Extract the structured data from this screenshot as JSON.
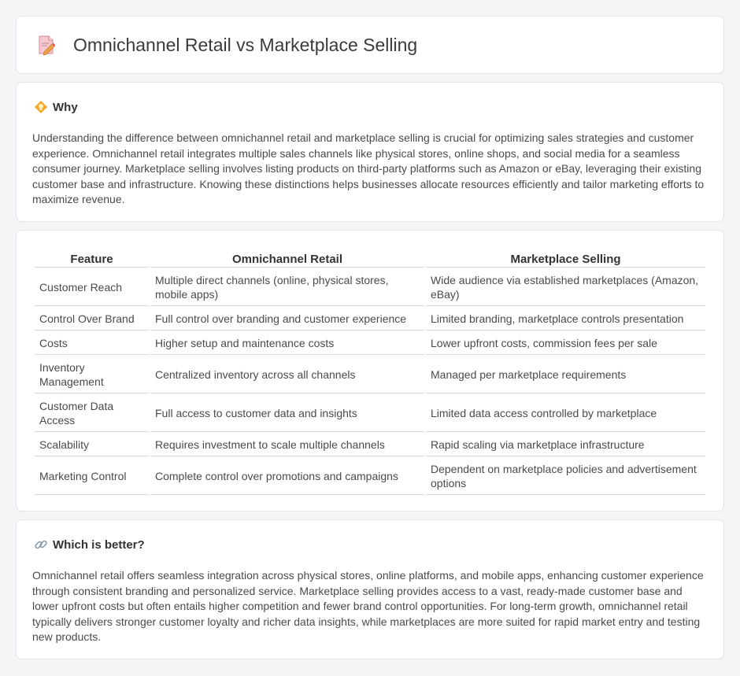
{
  "header": {
    "title": "Omnichannel Retail vs Marketplace Selling",
    "icon": "document-pencil-icon"
  },
  "why": {
    "title": "Why",
    "icon": "lightbulb-diamond-icon",
    "text": "Understanding the difference between omnichannel retail and marketplace selling is crucial for optimizing sales strategies and customer experience. Omnichannel retail integrates multiple sales channels like physical stores, online shops, and social media for a seamless consumer journey. Marketplace selling involves listing products on third-party platforms such as Amazon or eBay, leveraging their existing customer base and infrastructure. Knowing these distinctions helps businesses allocate resources efficiently and tailor marketing efforts to maximize revenue."
  },
  "table": {
    "headers": [
      "Feature",
      "Omnichannel Retail",
      "Marketplace Selling"
    ],
    "rows": [
      [
        "Customer Reach",
        "Multiple direct channels (online, physical stores, mobile apps)",
        "Wide audience via established marketplaces (Amazon, eBay)"
      ],
      [
        "Control Over Brand",
        "Full control over branding and customer experience",
        "Limited branding, marketplace controls presentation"
      ],
      [
        "Costs",
        "Higher setup and maintenance costs",
        "Lower upfront costs, commission fees per sale"
      ],
      [
        "Inventory Management",
        "Centralized inventory across all channels",
        "Managed per marketplace requirements"
      ],
      [
        "Customer Data Access",
        "Full access to customer data and insights",
        "Limited data access controlled by marketplace"
      ],
      [
        "Scalability",
        "Requires investment to scale multiple channels",
        "Rapid scaling via marketplace infrastructure"
      ],
      [
        "Marketing Control",
        "Complete control over promotions and campaigns",
        "Dependent on marketplace policies and advertisement options"
      ]
    ]
  },
  "better": {
    "title": "Which is better?",
    "icon": "link-icon",
    "text": "Omnichannel retail offers seamless integration across physical stores, online platforms, and mobile apps, enhancing customer experience through consistent branding and personalized service. Marketplace selling provides access to a vast, ready-made customer base and lower upfront costs but often entails higher competition and fewer brand control opportunities. For long-term growth, omnichannel retail typically delivers stronger customer loyalty and richer data insights, while marketplaces are more suited for rapid market entry and testing new products."
  }
}
